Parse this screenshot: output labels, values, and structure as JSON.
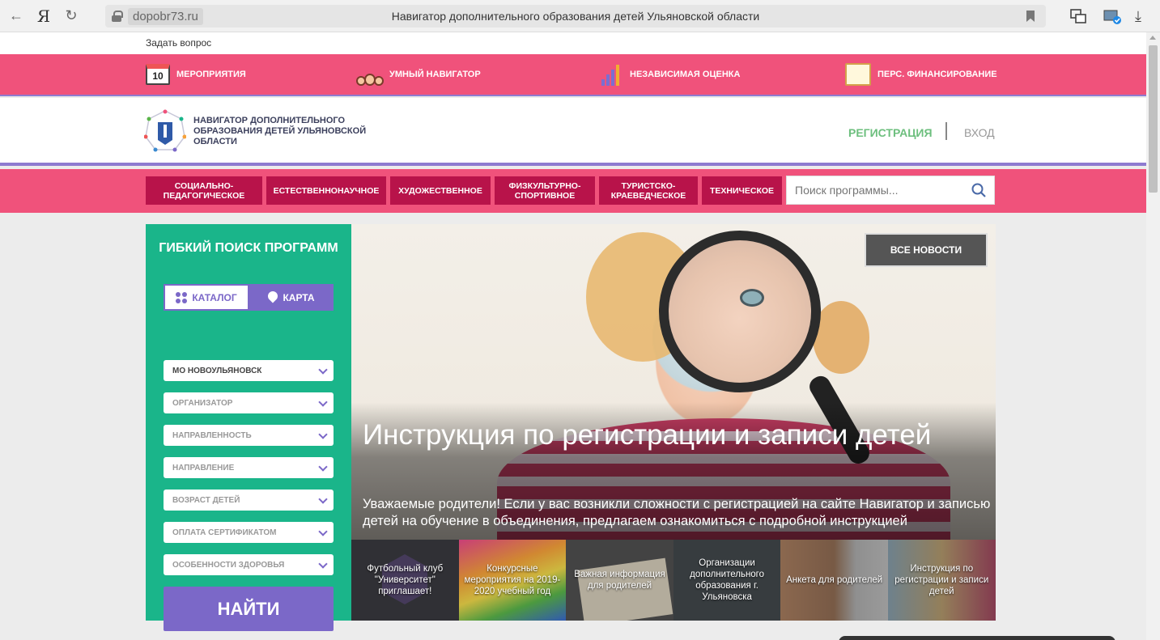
{
  "browser": {
    "back_glyph": "←",
    "yandex_logo": "Я",
    "reload_glyph": "↻",
    "domain": "dopobr73.ru",
    "page_title": "Навигатор дополнительного образования детей Ульяновской области",
    "download_glyph": "⤓"
  },
  "topline": {
    "ask": "Задать вопрос"
  },
  "topnav": {
    "calendar_day": "10",
    "items": [
      {
        "label": "Мероприятия",
        "icon": "calendar-icon"
      },
      {
        "label": "Умный навигатор",
        "icon": "people-icon"
      },
      {
        "label": "Независимая оценка",
        "icon": "chart-icon"
      },
      {
        "label": "Перс. финансирование",
        "icon": "certificate-icon"
      }
    ]
  },
  "header": {
    "logo_text": "Навигатор дополнительного образования детей Ульяновской области",
    "register": "Регистрация",
    "login": "Вход"
  },
  "categories": [
    "Социально-педагогическое",
    "Естественнонаучное",
    "Художественное",
    "Физкультурно-спортивное",
    "Туристско-краеведческое",
    "Техническое"
  ],
  "search": {
    "placeholder": "Поиск программы..."
  },
  "filter": {
    "title": "Гибкий поиск программ",
    "tab_catalog": "Каталог",
    "tab_map": "Карта",
    "selects": [
      "МО Новоульяновск",
      "Организатор",
      "Направленность",
      "Направление",
      "Возраст детей",
      "Оплата сертификатом",
      "Особенности здоровья"
    ],
    "find_button": "Найти"
  },
  "hero": {
    "all_news": "Все новости",
    "title": "Инструкция по регистрации и записи детей",
    "text": "Уважаемые родители! Если у вас возникли сложности с регистрацией на сайте Навигатор и записью детей на обучение в объединения, предлагаем ознакомиться с подробной инструкцией"
  },
  "thumbnails": [
    "Футбольный клуб \"Университет\" приглашает!",
    "Конкурсные мероприятия на 2019-2020 учебный год",
    "Важная информация для родителей",
    "Организации дополнительного образования г. Ульяновска",
    "Анкета для родителей",
    "Инструкция по регистрации и записи детей"
  ],
  "colors": {
    "pink": "#f0527b",
    "crimson": "#b8134a",
    "green": "#1ab58a",
    "purple": "#7b68c8",
    "register_green": "#6dbf7e"
  }
}
